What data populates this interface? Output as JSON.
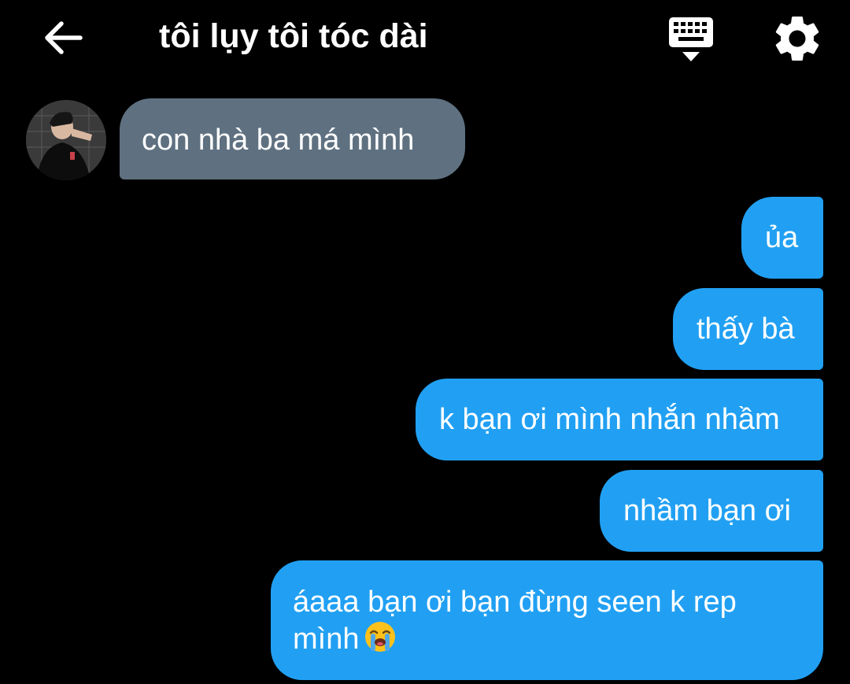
{
  "header": {
    "title": "tôi lụy tôi tóc dài",
    "back_icon": "arrow-left-icon",
    "keyboard_icon": "keyboard-icon",
    "settings_icon": "gear-icon"
  },
  "colors": {
    "background": "#000000",
    "incoming_bubble": "#5f7181",
    "outgoing_bubble": "#21a0f3",
    "text": "#ffffff"
  },
  "messages": [
    {
      "sender": "other",
      "text": "con nhà ba má mình"
    },
    {
      "sender": "me",
      "text": "ủa"
    },
    {
      "sender": "me",
      "text": "thấy bà"
    },
    {
      "sender": "me",
      "text": "k bạn ơi mình nhắn nhầm"
    },
    {
      "sender": "me",
      "text": "nhầm bạn ơi"
    },
    {
      "sender": "me",
      "text_line1": "áaaa bạn ơi bạn đừng seen k rep",
      "text_line2": "mình",
      "emoji": "loudly-crying-face-emoji"
    }
  ]
}
